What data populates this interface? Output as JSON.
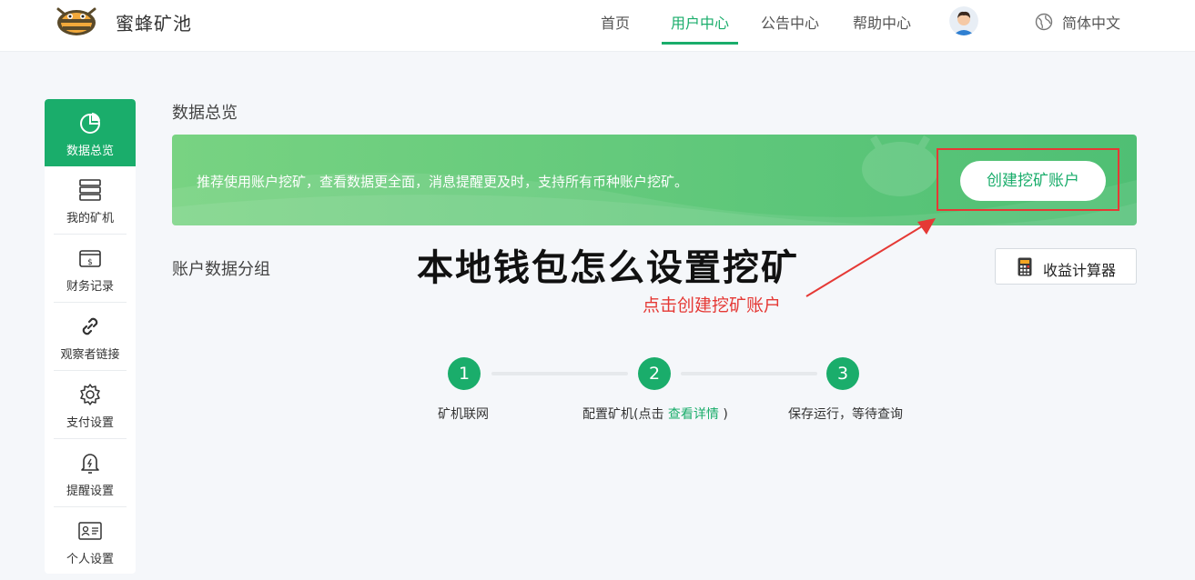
{
  "header": {
    "brand": "蜜蜂矿池",
    "nav": [
      "首页",
      "用户中心",
      "公告中心",
      "帮助中心"
    ],
    "active_nav": "用户中心",
    "language": "简体中文"
  },
  "sidebar": {
    "items": [
      {
        "label": "数据总览",
        "icon": "pie-chart-icon"
      },
      {
        "label": "我的矿机",
        "icon": "server-icon"
      },
      {
        "label": "财务记录",
        "icon": "wallet-icon"
      },
      {
        "label": "观察者链接",
        "icon": "link-icon"
      },
      {
        "label": "支付设置",
        "icon": "gear-icon"
      },
      {
        "label": "提醒设置",
        "icon": "bell-icon"
      },
      {
        "label": "个人设置",
        "icon": "id-card-icon"
      }
    ],
    "active": "数据总览"
  },
  "main": {
    "title": "数据总览",
    "banner_text": "推荐使用账户挖矿，查看数据更全面，消息提醒更及时，支持所有币种账户挖矿。",
    "create_button": "创建挖矿账户",
    "group_title": "账户数据分组",
    "calc_button": "收益计算器",
    "steps": [
      {
        "number": "1",
        "label": "矿机联网"
      },
      {
        "number": "2",
        "label_prefix": "配置矿机(点击 ",
        "link": "查看详情",
        "label_suffix": " )"
      },
      {
        "number": "3",
        "label": "保存运行，等待查询"
      }
    ]
  },
  "annotation": {
    "overlay_title": "本地钱包怎么设置挖矿",
    "hint": "点击创建挖矿账户"
  },
  "colors": {
    "accent": "#1aad6b",
    "annotation": "#e53935"
  }
}
